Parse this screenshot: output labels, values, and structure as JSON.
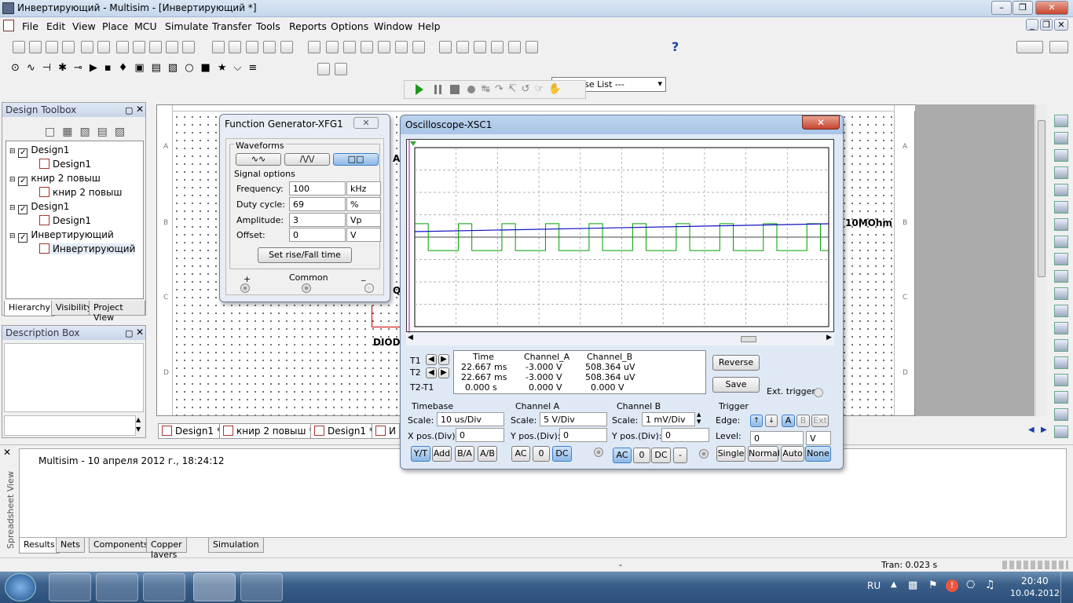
{
  "window": {
    "title": "Инвертирующий - Multisim - [Инвертирующий *]"
  },
  "menu": [
    "File",
    "Edit",
    "View",
    "Place",
    "MCU",
    "Simulate",
    "Transfer",
    "Tools",
    "Reports",
    "Options",
    "Window",
    "Help"
  ],
  "toolbar": {
    "in_use_list": "--- In Use List ---",
    "help": "?"
  },
  "design_toolbox": {
    "title": "Design Toolbox",
    "tree": [
      {
        "label": "Design1",
        "child": "Design1"
      },
      {
        "label": "книр 2 повыш",
        "child": "книр 2 повыш"
      },
      {
        "label": "Design1",
        "child": "Design1"
      },
      {
        "label": "Инвертирующий",
        "child": "Инвертирующий"
      }
    ],
    "tabs": [
      "Hierarchy",
      "Visibility",
      "Project View"
    ]
  },
  "description_box": {
    "title": "Description Box"
  },
  "sheet_tabs": [
    "Design1 *",
    "книр 2 повыш *",
    "Design1 *",
    "И"
  ],
  "ruler": {
    "rows": [
      "A",
      "B",
      "C",
      "D"
    ]
  },
  "canvas_labels": {
    "a": "A",
    "q": "Q",
    "diode": "DIOD",
    "res": "10MOhm"
  },
  "func_gen": {
    "title": "Function Generator-XFG1",
    "waveforms_label": "Waveforms",
    "signal_options_label": "Signal options",
    "rows": [
      {
        "label": "Frequency:",
        "value": "100",
        "unit": "kHz"
      },
      {
        "label": "Duty cycle:",
        "value": "69",
        "unit": "%"
      },
      {
        "label": "Amplitude:",
        "value": "3",
        "unit": "Vp"
      },
      {
        "label": "Offset:",
        "value": "0",
        "unit": "V"
      }
    ],
    "set_rise": "Set rise/Fall time",
    "plus": "+",
    "common": "Common",
    "minus": "_"
  },
  "scope": {
    "title": "Oscilloscope-XSC1",
    "meas_headers": [
      "Time",
      "Channel_A",
      "Channel_B"
    ],
    "t1": {
      "label": "T1",
      "time": "22.667 ms",
      "a": "-3.000 V",
      "b": "508.364 uV"
    },
    "t2": {
      "label": "T2",
      "time": "22.667 ms",
      "a": "-3.000 V",
      "b": "508.364 uV"
    },
    "dt": {
      "label": "T2-T1",
      "time": "0.000 s",
      "a": "0.000 V",
      "b": "0.000 V"
    },
    "reverse": "Reverse",
    "save": "Save",
    "ext_trigger": "Ext. trigger",
    "timebase": {
      "title": "Timebase",
      "scale_label": "Scale:",
      "scale": "10 us/Div",
      "pos_label": "X pos.(Div):",
      "pos": "0",
      "buttons": [
        "Y/T",
        "Add",
        "B/A",
        "A/B"
      ]
    },
    "cha": {
      "title": "Channel A",
      "scale_label": "Scale:",
      "scale": "5  V/Div",
      "pos_label": "Y pos.(Div):",
      "pos": "0",
      "buttons": [
        "AC",
        "0",
        "DC"
      ]
    },
    "chb": {
      "title": "Channel B",
      "scale_label": "Scale:",
      "scale": "1 mV/Div",
      "pos_label": "Y pos.(Div):",
      "pos": "0",
      "buttons": [
        "AC",
        "0",
        "DC",
        "-"
      ]
    },
    "trigger": {
      "title": "Trigger",
      "edge_label": "Edge:",
      "edge_buttons": [
        "A",
        "B",
        "Ext"
      ],
      "level_label": "Level:",
      "level": "0",
      "level_unit": "V",
      "buttons": [
        "Single",
        "Normal",
        "Auto",
        "None"
      ]
    },
    "colors": {
      "cha": "#00a000",
      "chb": "#1010c0"
    }
  },
  "spreadsheet": {
    "side_label": "Spreadsheet View",
    "message": "Multisim  -  10 апреля 2012 г., 18:24:12",
    "tabs": [
      "Results",
      "Nets",
      "Components",
      "Copper layers",
      "Simulation"
    ]
  },
  "status": {
    "middle": "-",
    "tran": "Tran: 0.023 s"
  },
  "taskbar": {
    "lang": "RU",
    "time": "20:40",
    "date": "10.04.2012"
  }
}
